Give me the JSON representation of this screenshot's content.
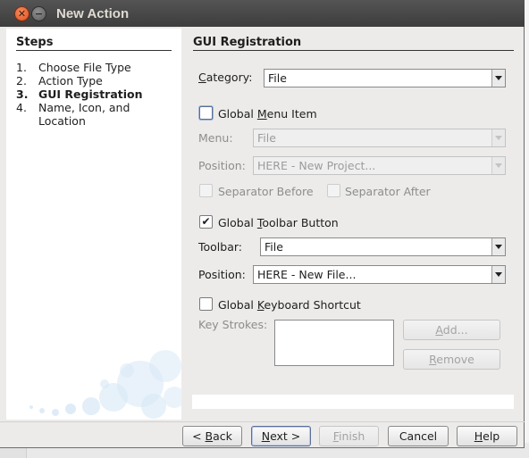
{
  "window": {
    "title": "New Action"
  },
  "steps": {
    "title": "Steps",
    "items": [
      {
        "num": "1.",
        "label": "Choose File Type"
      },
      {
        "num": "2.",
        "label": "Action Type"
      },
      {
        "num": "3.",
        "label": "GUI Registration"
      },
      {
        "num": "4.",
        "label": "Name, Icon, and Location"
      }
    ],
    "current_index": 2
  },
  "panel": {
    "title": "GUI Registration",
    "category": {
      "label": "Category:",
      "value": "File"
    },
    "global_menu_item": {
      "label": "Global Menu Item",
      "checked": false
    },
    "menu": {
      "label": "Menu:",
      "value": "File"
    },
    "menu_position": {
      "label": "Position:",
      "value": "HERE - New Project..."
    },
    "separator_before": {
      "label": "Separator Before",
      "checked": false
    },
    "separator_after": {
      "label": "Separator After",
      "checked": false
    },
    "global_toolbar_button": {
      "label": "Global Toolbar Button",
      "checked": true
    },
    "toolbar": {
      "label": "Toolbar:",
      "value": "File"
    },
    "toolbar_position": {
      "label": "Position:",
      "value": "HERE - New File..."
    },
    "global_keyboard_shortcut": {
      "label": "Global Keyboard Shortcut",
      "checked": false
    },
    "key_strokes": {
      "label": "Key Strokes:",
      "value": ""
    },
    "add_button": "Add...",
    "remove_button": "Remove"
  },
  "footer": {
    "back": "< Back",
    "next": "Next >",
    "finish": "Finish",
    "cancel": "Cancel",
    "help": "Help"
  },
  "colors": {
    "titlebar": "#3d3d3d",
    "close_button": "#e0521f",
    "dialog_bg": "#ecebe9"
  }
}
